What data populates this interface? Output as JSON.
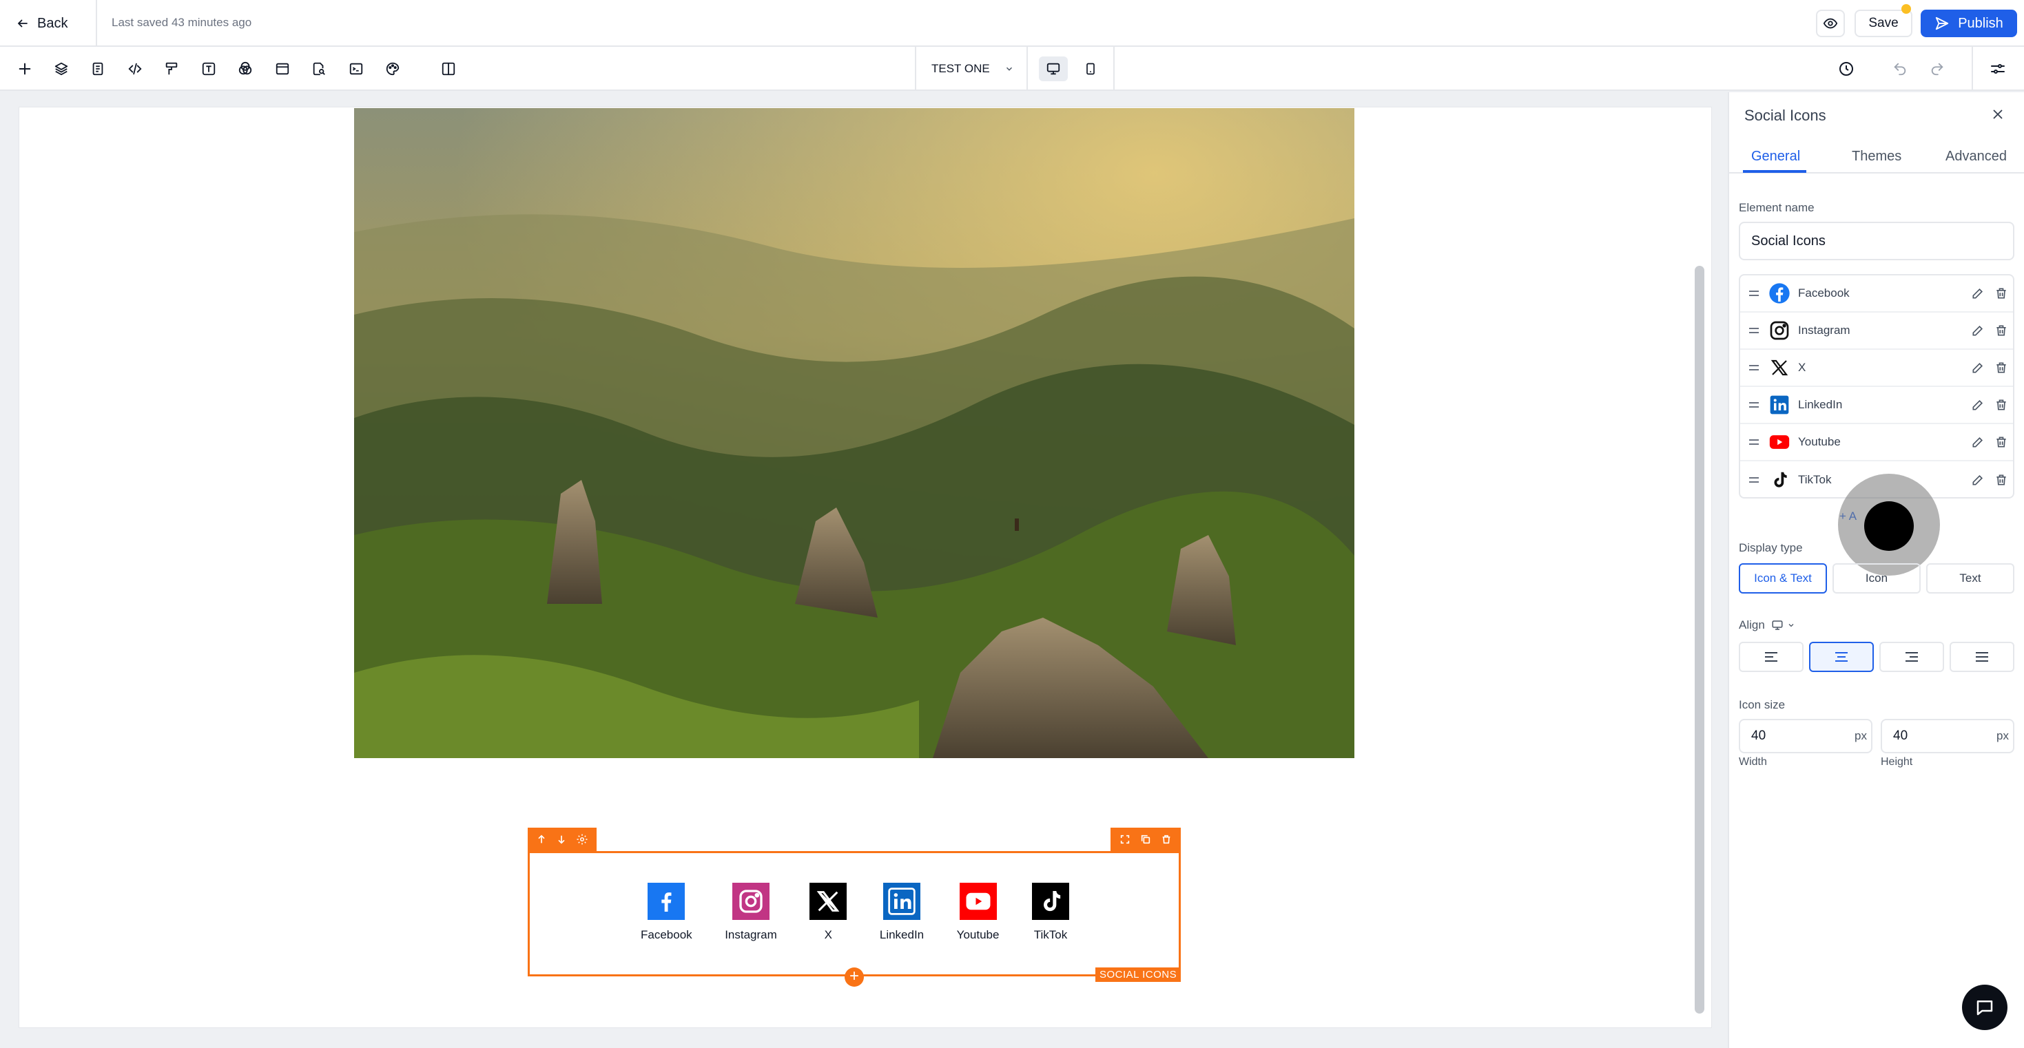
{
  "topbar": {
    "back_label": "Back",
    "last_saved": "Last saved 43 minutes ago",
    "save_label": "Save",
    "publish_label": "Publish"
  },
  "toolbar": {
    "page_name": "TEST ONE",
    "tools": [
      "add-icon",
      "layers-icon",
      "page-icon",
      "code-icon",
      "paint-roller-icon",
      "text-icon",
      "blend-icon",
      "layout-icon",
      "search-page-icon",
      "terminal-icon",
      "palette-icon",
      "split-view-icon"
    ]
  },
  "canvas": {
    "social_element_tag": "SOCIAL ICONS",
    "social_items": [
      {
        "label": "Facebook",
        "color": "#1877f2"
      },
      {
        "label": "Instagram",
        "color": "#c13584"
      },
      {
        "label": "X",
        "color": "#000000"
      },
      {
        "label": "LinkedIn",
        "color": "#0a66c2"
      },
      {
        "label": "Youtube",
        "color": "#ff0000"
      },
      {
        "label": "TikTok",
        "color": "#000000"
      }
    ]
  },
  "panel": {
    "title": "Social Icons",
    "tabs": {
      "general": "General",
      "themes": "Themes",
      "advanced": "Advanced"
    },
    "element_name_label": "Element name",
    "element_name_value": "Social Icons",
    "list": [
      "Facebook",
      "Instagram",
      "X",
      "LinkedIn",
      "Youtube",
      "TikTok"
    ],
    "add_label": "+ A",
    "display_type_label": "Display type",
    "display_types": [
      "Icon & Text",
      "Icon",
      "Text"
    ],
    "display_type_selected": "Icon & Text",
    "align_label": "Align",
    "align_selected": "center",
    "icon_size_label": "Icon size",
    "width_value": "40",
    "height_value": "40",
    "unit": "px",
    "width_label": "Width",
    "height_label": "Height"
  },
  "colors": {
    "accent": "#1f5fe8",
    "selection": "#f97316"
  }
}
